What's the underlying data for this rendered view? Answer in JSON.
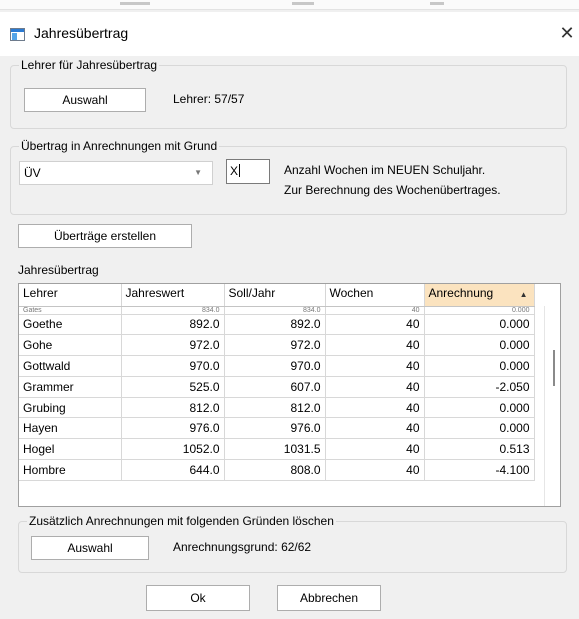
{
  "window": {
    "title": "Jahresübertrag",
    "close_glyph": "✕"
  },
  "icons": {
    "window": "window-app-icon",
    "close": "close-icon",
    "combo_arrow": "chevron-down-icon",
    "sort": "sort-asc-icon"
  },
  "lehrer_group": {
    "legend": "Lehrer für Jahresübertrag",
    "button": "Auswahl",
    "count_text": "Lehrer: 57/57"
  },
  "uebertrag_group": {
    "legend": "Übertrag in Anrechnungen mit Grund",
    "combo_value": "ÜV",
    "weeks_value": "X",
    "hint_line1": "Anzahl Wochen im NEUEN Schuljahr.",
    "hint_line2": "Zur Berechnung des Wochenübertrages."
  },
  "create_button": "Überträge erstellen",
  "table_label": "Jahresübertrag",
  "table": {
    "columns": [
      "Lehrer",
      "Jahreswert",
      "Soll/Jahr",
      "Wochen",
      "Anrechnung"
    ],
    "sorted_column": "Anrechnung",
    "partial_row": [
      "Gates",
      "834.0",
      "834.0",
      "40",
      "0.000"
    ],
    "rows": [
      [
        "Goethe",
        "892.0",
        "892.0",
        "40",
        "0.000"
      ],
      [
        "Gohe",
        "972.0",
        "972.0",
        "40",
        "0.000"
      ],
      [
        "Gottwald",
        "970.0",
        "970.0",
        "40",
        "0.000"
      ],
      [
        "Grammer",
        "525.0",
        "607.0",
        "40",
        "-2.050"
      ],
      [
        "Grubing",
        "812.0",
        "812.0",
        "40",
        "0.000"
      ],
      [
        "Hayen",
        "976.0",
        "976.0",
        "40",
        "0.000"
      ],
      [
        "Hogel",
        "1052.0",
        "1031.5",
        "40",
        "0.513"
      ],
      [
        "Hombre",
        "644.0",
        "808.0",
        "40",
        "-4.100"
      ]
    ]
  },
  "delete_group": {
    "legend": "Zusätzlich Anrechnungen mit folgenden Gründen löschen",
    "button": "Auswahl",
    "count_text": "Anrechnungsgrund: 62/62"
  },
  "buttons": {
    "ok": "Ok",
    "cancel": "Abbrechen"
  }
}
